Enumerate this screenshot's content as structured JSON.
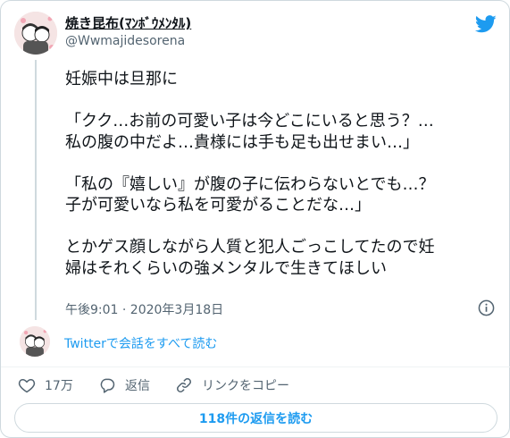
{
  "user": {
    "display_name": "焼き昆布(ﾏﾝﾎﾞｳﾒﾝﾀﾙ)",
    "username": "@Wwmajidesorena"
  },
  "tweet": {
    "text": "妊娠中は旦那に\n\n「クク…お前の可愛い子は今どこにいると思う？…\n私の腹の中だよ…貴様には手も足も出せまい…」\n\n「私の『嬉しい』が腹の子に伝わらないとでも…？\n子が可愛いなら私を可愛がることだな…」\n\nとかゲス顔しながら人質と犯人ごっこしてたので妊\n婦はそれくらいの強メンタルで生きてほしい",
    "timestamp": "午後9:01 · 2020年3月18日"
  },
  "thread": {
    "read_all_label": "Twitterで会話をすべて読む"
  },
  "actions": {
    "likes": "17万",
    "reply_label": "返信",
    "copy_link_label": "リンクをコピー"
  },
  "replies_button_label": "118件の返信を読む",
  "colors": {
    "accent": "#1d9bf0",
    "secondary_text": "#536471",
    "border": "#cfd9de"
  },
  "icons": {
    "brand": "twitter-bird-icon",
    "info": "info-icon",
    "like": "heart-icon",
    "reply": "reply-bubble-icon",
    "link": "link-icon"
  }
}
